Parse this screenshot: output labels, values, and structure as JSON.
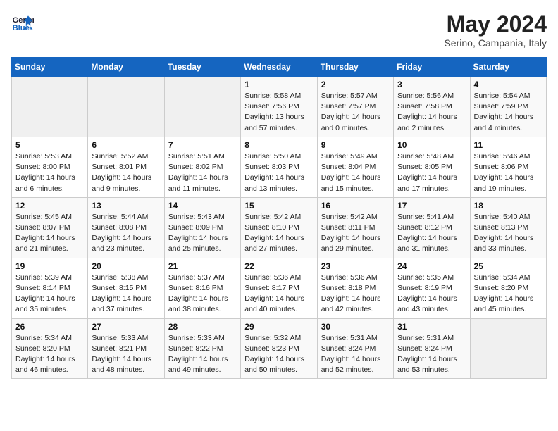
{
  "header": {
    "logo_line1": "General",
    "logo_line2": "Blue",
    "month_year": "May 2024",
    "location": "Serino, Campania, Italy"
  },
  "weekdays": [
    "Sunday",
    "Monday",
    "Tuesday",
    "Wednesday",
    "Thursday",
    "Friday",
    "Saturday"
  ],
  "weeks": [
    [
      {
        "day": "",
        "info": ""
      },
      {
        "day": "",
        "info": ""
      },
      {
        "day": "",
        "info": ""
      },
      {
        "day": "1",
        "info": "Sunrise: 5:58 AM\nSunset: 7:56 PM\nDaylight: 13 hours\nand 57 minutes."
      },
      {
        "day": "2",
        "info": "Sunrise: 5:57 AM\nSunset: 7:57 PM\nDaylight: 14 hours\nand 0 minutes."
      },
      {
        "day": "3",
        "info": "Sunrise: 5:56 AM\nSunset: 7:58 PM\nDaylight: 14 hours\nand 2 minutes."
      },
      {
        "day": "4",
        "info": "Sunrise: 5:54 AM\nSunset: 7:59 PM\nDaylight: 14 hours\nand 4 minutes."
      }
    ],
    [
      {
        "day": "5",
        "info": "Sunrise: 5:53 AM\nSunset: 8:00 PM\nDaylight: 14 hours\nand 6 minutes."
      },
      {
        "day": "6",
        "info": "Sunrise: 5:52 AM\nSunset: 8:01 PM\nDaylight: 14 hours\nand 9 minutes."
      },
      {
        "day": "7",
        "info": "Sunrise: 5:51 AM\nSunset: 8:02 PM\nDaylight: 14 hours\nand 11 minutes."
      },
      {
        "day": "8",
        "info": "Sunrise: 5:50 AM\nSunset: 8:03 PM\nDaylight: 14 hours\nand 13 minutes."
      },
      {
        "day": "9",
        "info": "Sunrise: 5:49 AM\nSunset: 8:04 PM\nDaylight: 14 hours\nand 15 minutes."
      },
      {
        "day": "10",
        "info": "Sunrise: 5:48 AM\nSunset: 8:05 PM\nDaylight: 14 hours\nand 17 minutes."
      },
      {
        "day": "11",
        "info": "Sunrise: 5:46 AM\nSunset: 8:06 PM\nDaylight: 14 hours\nand 19 minutes."
      }
    ],
    [
      {
        "day": "12",
        "info": "Sunrise: 5:45 AM\nSunset: 8:07 PM\nDaylight: 14 hours\nand 21 minutes."
      },
      {
        "day": "13",
        "info": "Sunrise: 5:44 AM\nSunset: 8:08 PM\nDaylight: 14 hours\nand 23 minutes."
      },
      {
        "day": "14",
        "info": "Sunrise: 5:43 AM\nSunset: 8:09 PM\nDaylight: 14 hours\nand 25 minutes."
      },
      {
        "day": "15",
        "info": "Sunrise: 5:42 AM\nSunset: 8:10 PM\nDaylight: 14 hours\nand 27 minutes."
      },
      {
        "day": "16",
        "info": "Sunrise: 5:42 AM\nSunset: 8:11 PM\nDaylight: 14 hours\nand 29 minutes."
      },
      {
        "day": "17",
        "info": "Sunrise: 5:41 AM\nSunset: 8:12 PM\nDaylight: 14 hours\nand 31 minutes."
      },
      {
        "day": "18",
        "info": "Sunrise: 5:40 AM\nSunset: 8:13 PM\nDaylight: 14 hours\nand 33 minutes."
      }
    ],
    [
      {
        "day": "19",
        "info": "Sunrise: 5:39 AM\nSunset: 8:14 PM\nDaylight: 14 hours\nand 35 minutes."
      },
      {
        "day": "20",
        "info": "Sunrise: 5:38 AM\nSunset: 8:15 PM\nDaylight: 14 hours\nand 37 minutes."
      },
      {
        "day": "21",
        "info": "Sunrise: 5:37 AM\nSunset: 8:16 PM\nDaylight: 14 hours\nand 38 minutes."
      },
      {
        "day": "22",
        "info": "Sunrise: 5:36 AM\nSunset: 8:17 PM\nDaylight: 14 hours\nand 40 minutes."
      },
      {
        "day": "23",
        "info": "Sunrise: 5:36 AM\nSunset: 8:18 PM\nDaylight: 14 hours\nand 42 minutes."
      },
      {
        "day": "24",
        "info": "Sunrise: 5:35 AM\nSunset: 8:19 PM\nDaylight: 14 hours\nand 43 minutes."
      },
      {
        "day": "25",
        "info": "Sunrise: 5:34 AM\nSunset: 8:20 PM\nDaylight: 14 hours\nand 45 minutes."
      }
    ],
    [
      {
        "day": "26",
        "info": "Sunrise: 5:34 AM\nSunset: 8:20 PM\nDaylight: 14 hours\nand 46 minutes."
      },
      {
        "day": "27",
        "info": "Sunrise: 5:33 AM\nSunset: 8:21 PM\nDaylight: 14 hours\nand 48 minutes."
      },
      {
        "day": "28",
        "info": "Sunrise: 5:33 AM\nSunset: 8:22 PM\nDaylight: 14 hours\nand 49 minutes."
      },
      {
        "day": "29",
        "info": "Sunrise: 5:32 AM\nSunset: 8:23 PM\nDaylight: 14 hours\nand 50 minutes."
      },
      {
        "day": "30",
        "info": "Sunrise: 5:31 AM\nSunset: 8:24 PM\nDaylight: 14 hours\nand 52 minutes."
      },
      {
        "day": "31",
        "info": "Sunrise: 5:31 AM\nSunset: 8:24 PM\nDaylight: 14 hours\nand 53 minutes."
      },
      {
        "day": "",
        "info": ""
      }
    ]
  ]
}
